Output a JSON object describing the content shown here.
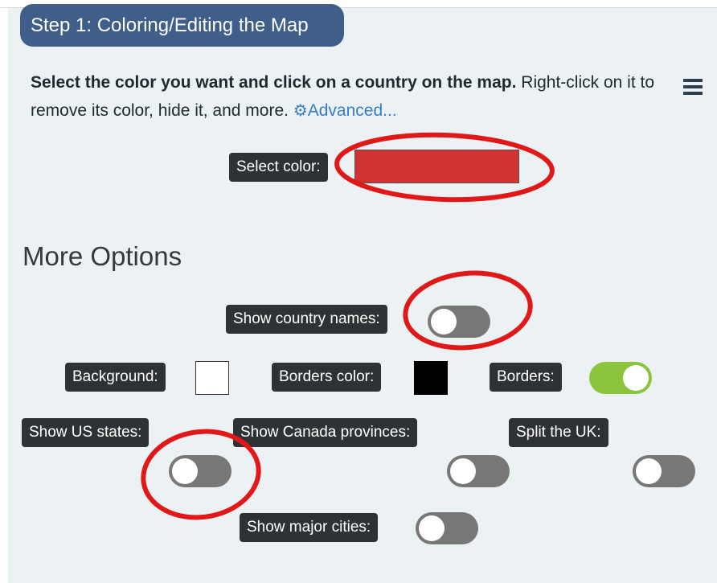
{
  "step_header": "Step 1: Coloring/Editing the Map",
  "intro": {
    "bold_text": "Select the color you want and click on a country on the map.",
    "normal_text": " Right-click on it to remove its color, hide it, and more. ",
    "advanced_link": "Advanced..."
  },
  "select_color": {
    "label": "Select color:",
    "value": "#d03332"
  },
  "more_options_heading": "More Options",
  "options": {
    "show_country_names": {
      "label": "Show country names:",
      "enabled": false
    },
    "background": {
      "label": "Background:",
      "color": "#ffffff"
    },
    "borders_color": {
      "label": "Borders color:",
      "color": "#000000"
    },
    "borders": {
      "label": "Borders:",
      "enabled": true
    },
    "show_us_states": {
      "label": "Show US states:",
      "enabled": false
    },
    "show_canada_provinces": {
      "label": "Show Canada provinces:",
      "enabled": false
    },
    "split_uk": {
      "label": "Split the UK:",
      "enabled": false
    },
    "show_major_cities": {
      "label": "Show major cities:",
      "enabled": false
    }
  },
  "colors": {
    "header_bg": "#3f5f8a",
    "panel_bg": "#ecf2f4",
    "label_bg": "#2f3234",
    "toggle_off": "#777777",
    "toggle_on": "#8cc43d",
    "annotation_red": "#e01818",
    "link": "#3a7bc8"
  },
  "icons": {
    "advanced": "gear-icon",
    "menu": "hamburger-menu-icon"
  }
}
